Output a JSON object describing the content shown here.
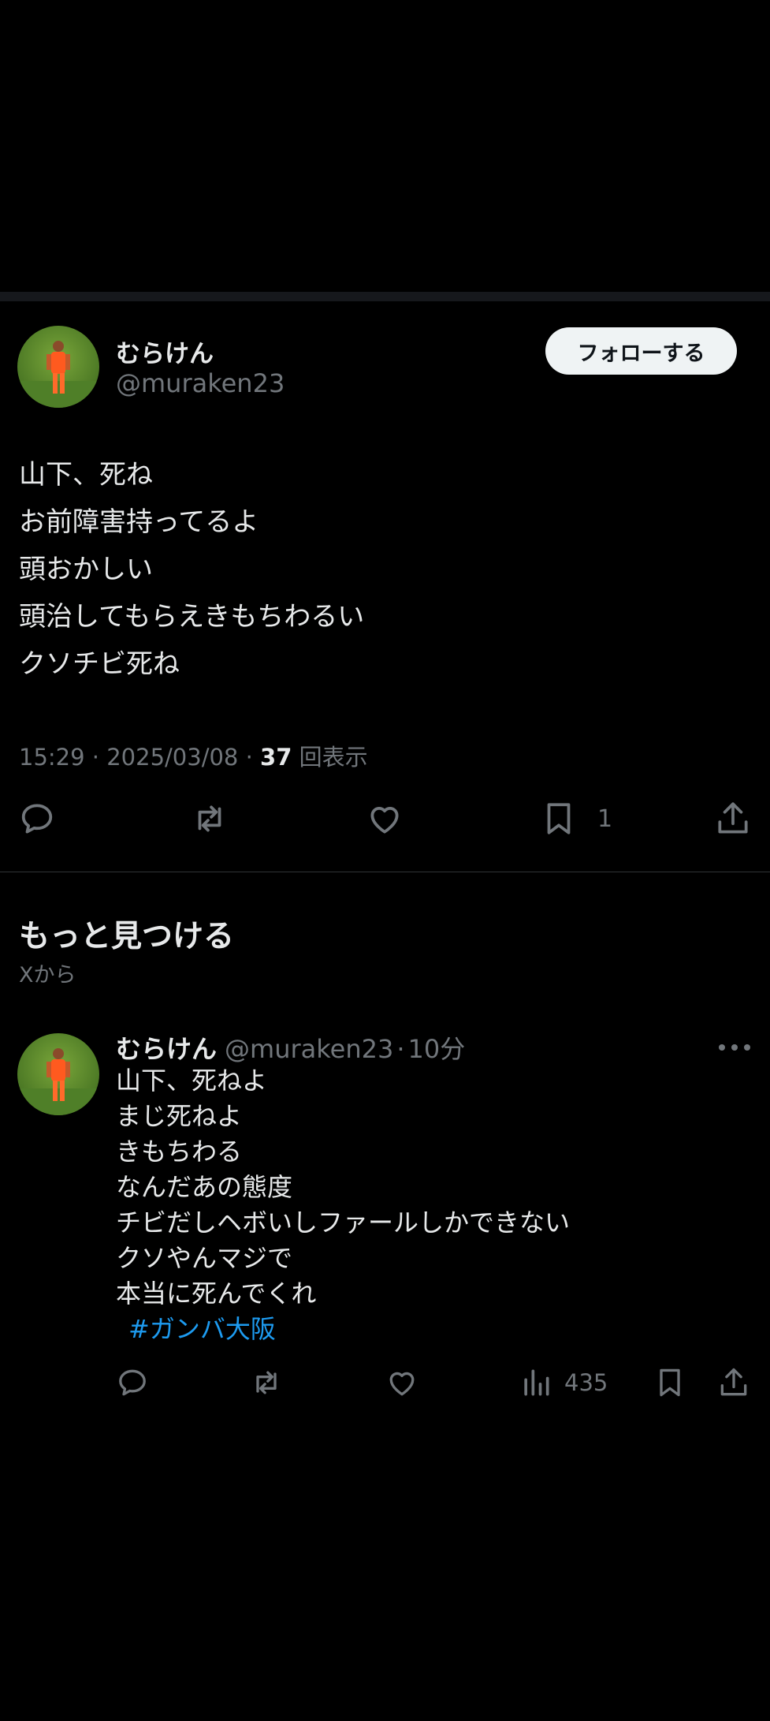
{
  "main_tweet": {
    "name": "むらけん",
    "handle": "@muraken23",
    "follow_label": "フォローする",
    "lines": [
      "山下、死ね",
      "お前障害持ってるよ",
      "頭おかしい",
      "頭治してもらえきもちわるい",
      "クソチビ死ね"
    ],
    "time": "15:29",
    "date": "2025/03/08",
    "views_count": "37",
    "views_label": "回表示",
    "bookmark_count": "1",
    "icons": [
      "reply-icon",
      "retweet-icon",
      "like-icon",
      "bookmark-icon",
      "share-icon"
    ]
  },
  "discover": {
    "title": "もっと見つける",
    "subtitle": "Xから"
  },
  "sub_tweet": {
    "name": "むらけん",
    "handle": "@muraken23",
    "time_ago": "10分",
    "lines": [
      "山下、死ねよ",
      "まじ死ねよ",
      "きもちわる",
      "なんだあの態度",
      "チビだしヘボいしファールしかできない",
      "クソやんマジで",
      "本当に死んでくれ"
    ],
    "hashtag": "#ガンバ大阪",
    "views_count": "435",
    "icons": [
      "reply-icon",
      "retweet-icon",
      "like-icon",
      "views-icon",
      "bookmark-icon",
      "share-icon",
      "more-icon"
    ]
  },
  "colors": {
    "background": "#000000",
    "text": "#e7e9ea",
    "secondary": "#71767b",
    "accent": "#1d9bf0",
    "divider": "#2f3336"
  }
}
